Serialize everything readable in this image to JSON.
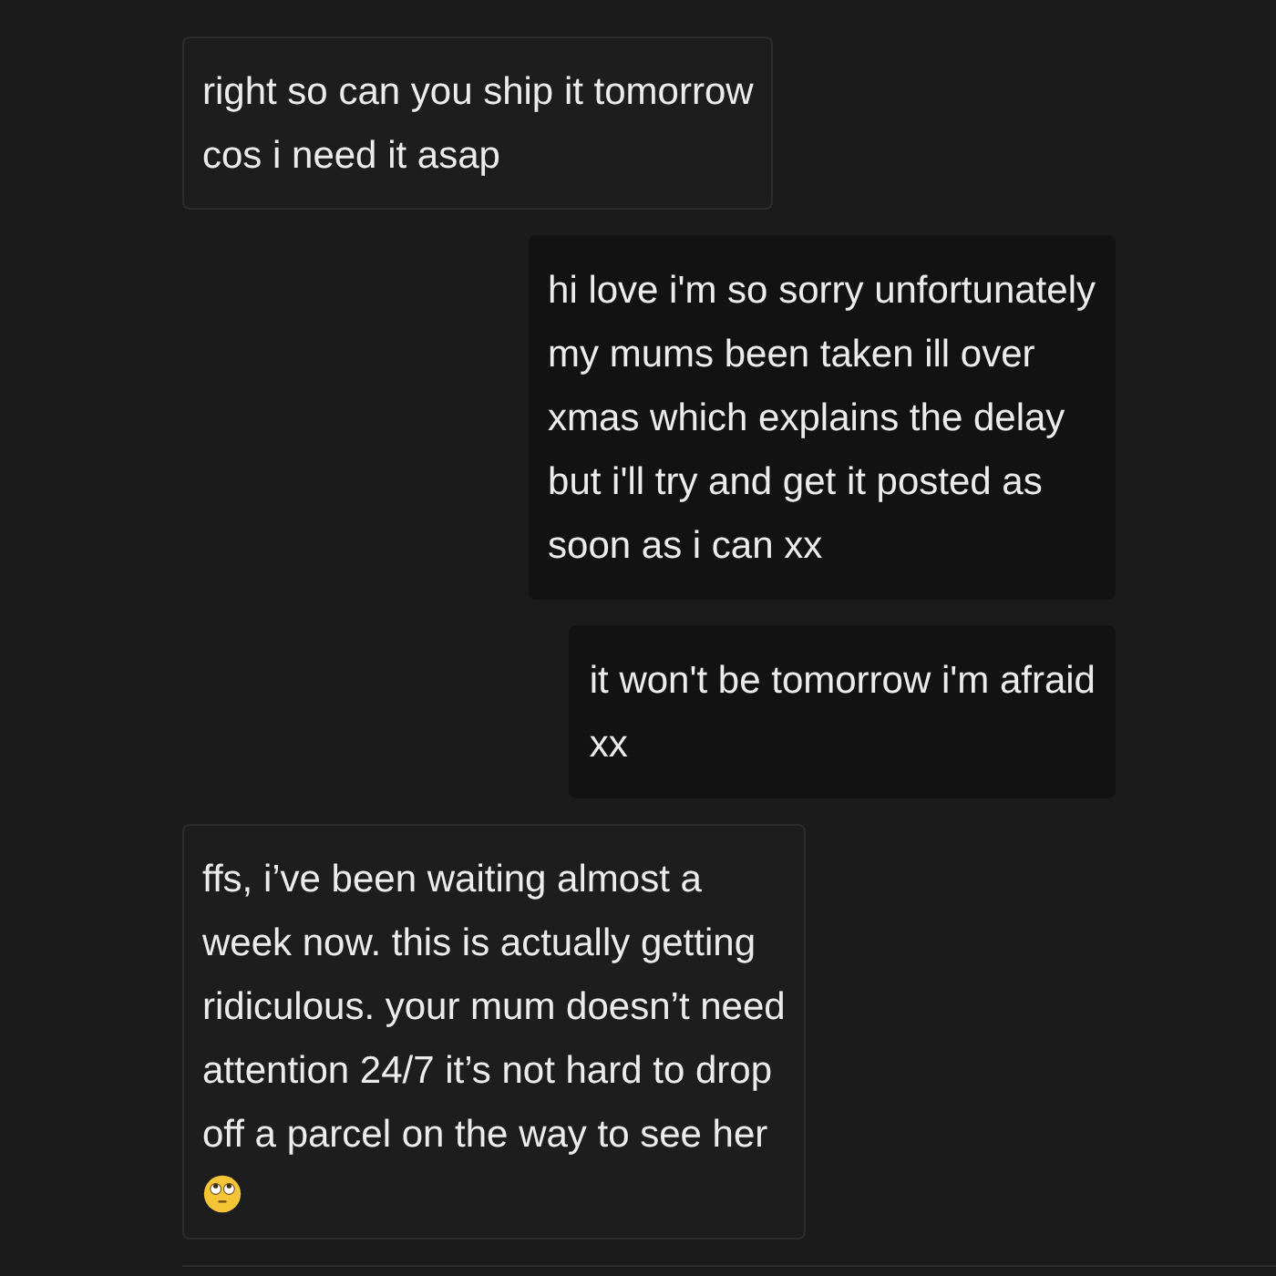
{
  "messages": [
    {
      "kind": "received",
      "lines": [
        "right so can you ship it tomorrow",
        "cos i need it asap"
      ]
    },
    {
      "kind": "sent",
      "lines": [
        "hi love i'm so sorry unfortunately",
        "my mums been taken ill over",
        "xmas which explains the delay",
        "but i'll try and get it posted as",
        "soon as i can xx"
      ]
    },
    {
      "kind": "sent",
      "lines": [
        "it won't be tomorrow i'm afraid",
        "xx"
      ]
    },
    {
      "kind": "received",
      "lines": [
        "ffs, i’ve been waiting almost a",
        "week now. this is actually getting",
        "ridiculous. your mum doesn’t need",
        "attention 24/7 it’s not hard to drop",
        "off a parcel on the way to see her"
      ],
      "emoji": true
    }
  ]
}
